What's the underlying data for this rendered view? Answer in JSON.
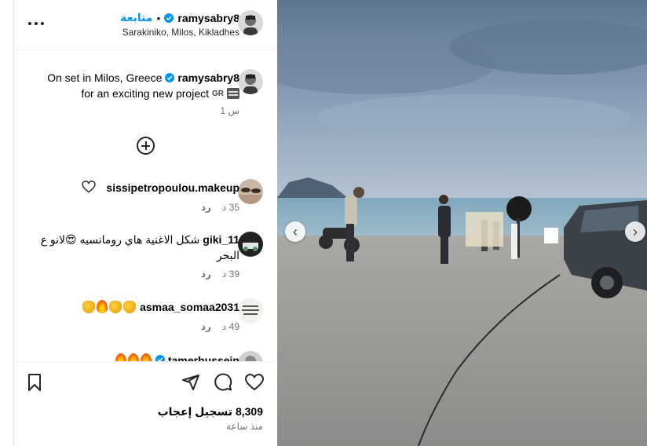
{
  "header": {
    "username": "ramysabry8",
    "follow_label": "متابعة",
    "separator": "•",
    "location": "Sarakiniko, Milos, Kikladhes"
  },
  "caption": {
    "username": "ramysabry8",
    "line1": "On set in Milos, Greece",
    "line2": "for an exciting new project",
    "flag_label": "GR",
    "time": "1 س"
  },
  "comments": [
    {
      "user": "sissipetropoulou.makeup",
      "text": "",
      "time": "35 د",
      "reply": "رد"
    },
    {
      "user": "giki_11",
      "text": "شكل الاغنية هاي رومانسيه 😍لانو ع البحر",
      "time": "39 د",
      "reply": "رد"
    },
    {
      "user": "asmaa_somaa2031",
      "text": "",
      "time": "49 د",
      "reply": "رد"
    },
    {
      "user": "tamerhussein",
      "text": "",
      "time": "",
      "reply": ""
    }
  ],
  "actions": {
    "likes_count": "8,309",
    "likes_label": "تسجيل إعجاب",
    "post_time": "منذ ساعة"
  },
  "icons": [
    "more-icon",
    "verified-icon",
    "add-comment-icon",
    "heart-icon",
    "bookmark-icon",
    "share-icon",
    "comment-icon",
    "like-icon",
    "chevron-left-icon",
    "chevron-right-icon"
  ],
  "colors": {
    "link": "#0095f6",
    "verified": "#0095f6",
    "muted": "#737373"
  }
}
